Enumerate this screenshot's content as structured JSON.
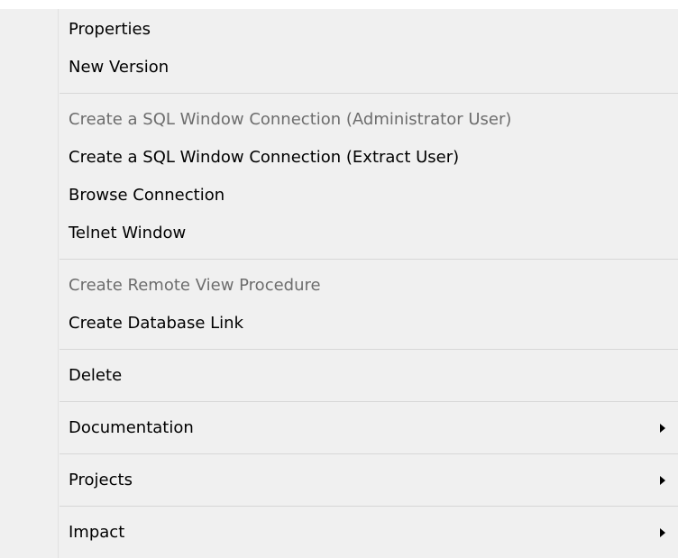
{
  "menu": {
    "group1": {
      "properties": "Properties",
      "new_version": "New Version"
    },
    "group2": {
      "sql_admin": "Create a SQL Window Connection (Administrator User)",
      "sql_extract": "Create a SQL Window Connection (Extract User)",
      "browse_connection": "Browse Connection",
      "telnet_window": "Telnet Window"
    },
    "group3": {
      "remote_view": "Create Remote View Procedure",
      "database_link": "Create Database Link"
    },
    "group4": {
      "delete": "Delete"
    },
    "group5": {
      "documentation": "Documentation"
    },
    "group6": {
      "projects": "Projects"
    },
    "group7": {
      "impact": "Impact"
    },
    "icons": {
      "submenu_arrow": "chevron-right-icon"
    },
    "colors": {
      "background": "#f0f0f0",
      "text": "#000000",
      "disabled_text": "#6d6d6d",
      "separator": "#d7d7d7"
    }
  }
}
